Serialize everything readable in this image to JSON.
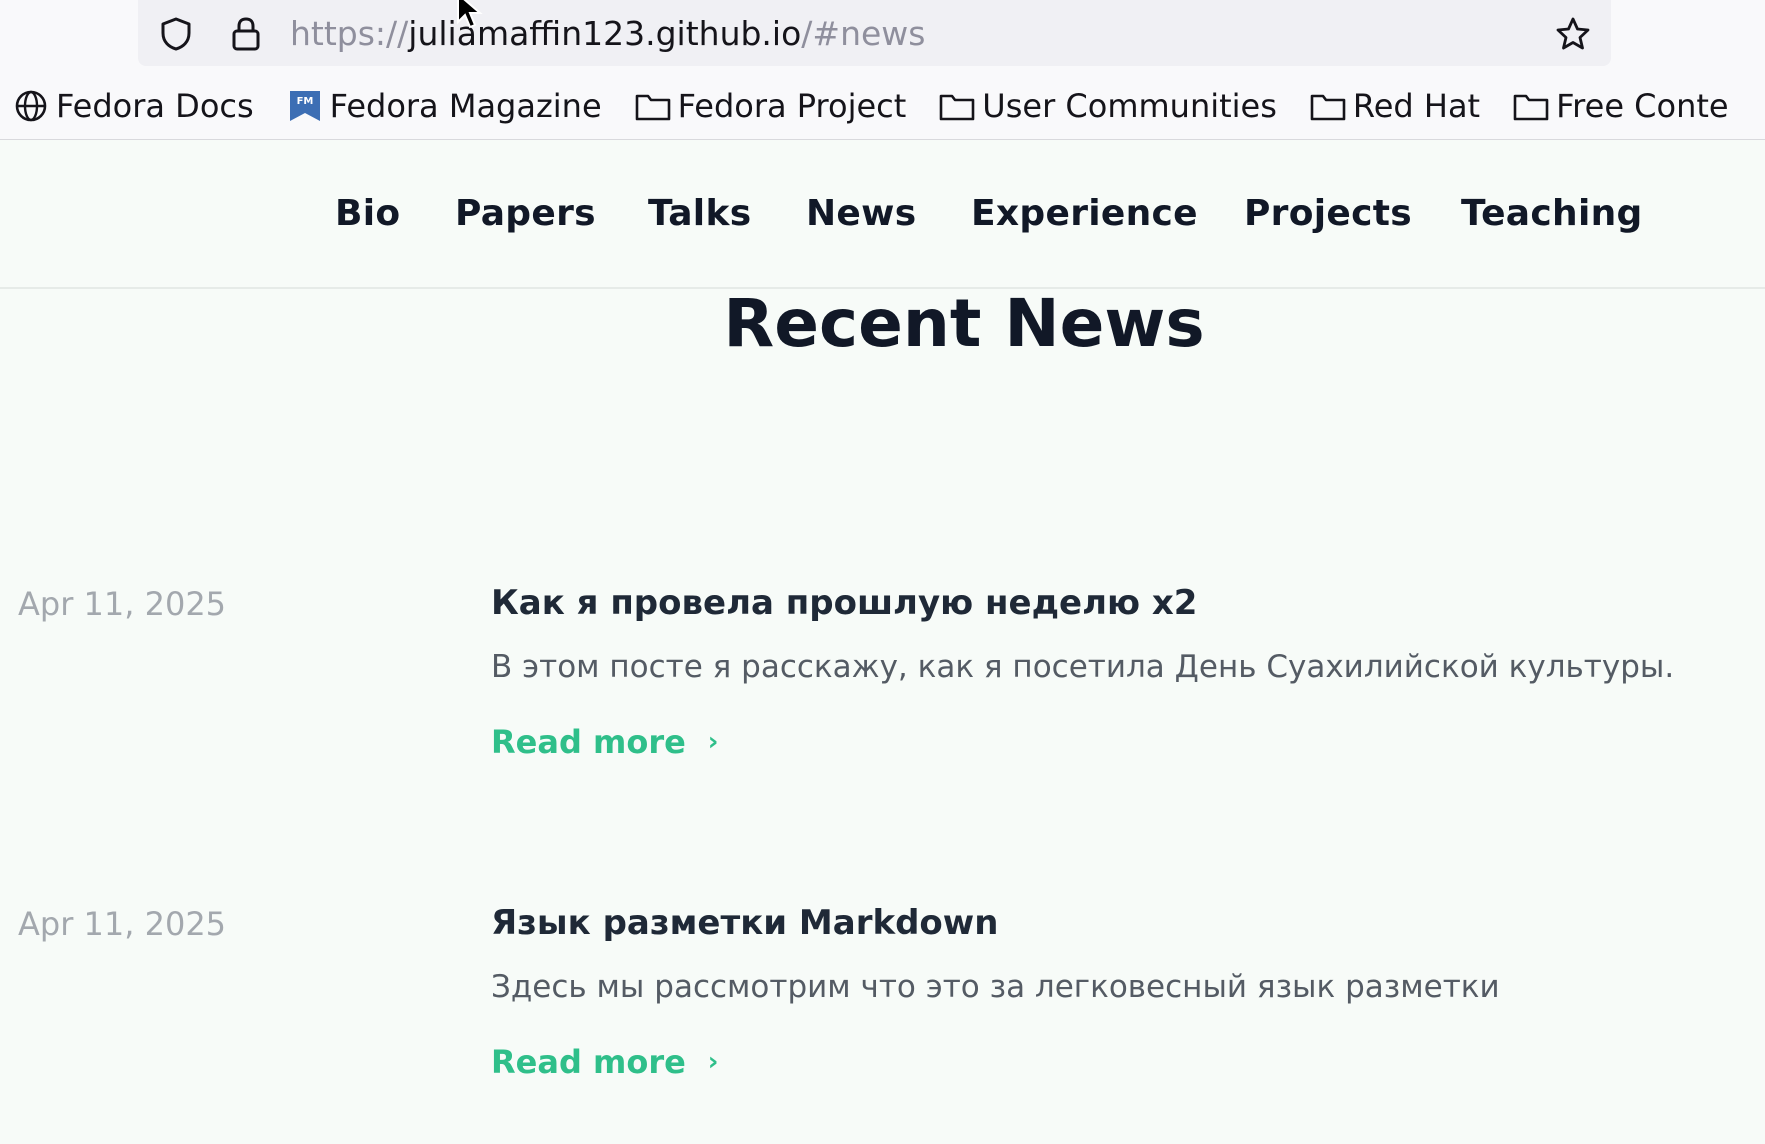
{
  "browser": {
    "url_prefix": "https://",
    "url_host": "juliamaffin123.github.io",
    "url_suffix": "/#news",
    "bookmarks": [
      {
        "label": "Fedora Docs",
        "icon": "globe-icon"
      },
      {
        "label": "Fedora Magazine",
        "icon": "fedora-magazine-icon"
      },
      {
        "label": "Fedora Project",
        "icon": "folder-icon"
      },
      {
        "label": "User Communities",
        "icon": "folder-icon"
      },
      {
        "label": "Red Hat",
        "icon": "folder-icon"
      },
      {
        "label": "Free Conte",
        "icon": "folder-icon"
      }
    ]
  },
  "nav": {
    "items": [
      "Bio",
      "Papers",
      "Talks",
      "News",
      "Experience",
      "Projects",
      "Teaching"
    ]
  },
  "main": {
    "title": "Recent News",
    "news": [
      {
        "date": "Apr 11, 2025",
        "title": "Как я провела прошлую неделю x2",
        "excerpt": "В этом посте я расскажу, как я посетила День Суахилийской культуры.",
        "read_more": "Read more",
        "chevron": "›"
      },
      {
        "date": "Apr 11, 2025",
        "title": "Язык разметки Markdown",
        "excerpt": "Здесь мы рассмотрим что это за легковесный язык разметки",
        "read_more": "Read more",
        "chevron": "›"
      }
    ]
  },
  "colors": {
    "page_bg": "#f7fbf8",
    "accent": "#2fbf8a",
    "heading": "#111827",
    "date": "#a3a8ae"
  }
}
